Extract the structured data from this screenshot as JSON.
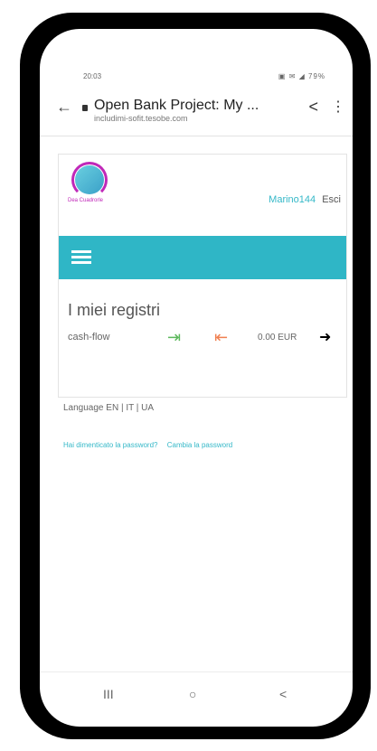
{
  "status": {
    "time": "20:03",
    "indicators": "▣ ✉ ◢ 79%"
  },
  "browser": {
    "title": "Open Bank Project: My ...",
    "url": "includimi-sofit.tesobe.com",
    "back_icon": "←",
    "share_icon": "<",
    "menu_icon": "⋮"
  },
  "header": {
    "logo_text": "Dea Cuadrorle",
    "username": "Marino144",
    "logout": "Esci"
  },
  "main": {
    "heading": "I miei registri",
    "ledgers": [
      {
        "name": "cash-flow",
        "amount": "0.00 EUR"
      }
    ]
  },
  "footer": {
    "language": "Language EN | IT | UA",
    "forgot_password": "Hai dimenticato la password?",
    "change_password": "Cambia la password"
  },
  "navbar": {
    "recent": "III",
    "home": "○",
    "back": "<"
  }
}
